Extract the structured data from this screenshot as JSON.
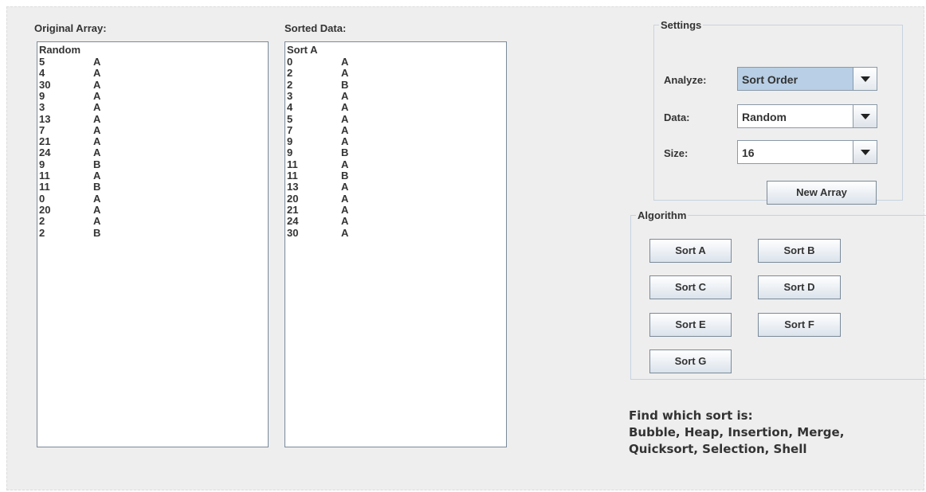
{
  "original": {
    "label": "Original Array:",
    "header": "Random",
    "rows": [
      {
        "num": "5",
        "letter": "A"
      },
      {
        "num": "4",
        "letter": "A"
      },
      {
        "num": "30",
        "letter": "A"
      },
      {
        "num": "9",
        "letter": "A"
      },
      {
        "num": "3",
        "letter": "A"
      },
      {
        "num": "13",
        "letter": "A"
      },
      {
        "num": "7",
        "letter": "A"
      },
      {
        "num": "21",
        "letter": "A"
      },
      {
        "num": "24",
        "letter": "A"
      },
      {
        "num": "9",
        "letter": "B"
      },
      {
        "num": "11",
        "letter": "A"
      },
      {
        "num": "11",
        "letter": "B"
      },
      {
        "num": "0",
        "letter": "A"
      },
      {
        "num": "20",
        "letter": "A"
      },
      {
        "num": "2",
        "letter": "A"
      },
      {
        "num": "2",
        "letter": "B"
      }
    ]
  },
  "sorted": {
    "label": "Sorted Data:",
    "header": "Sort A",
    "rows": [
      {
        "num": "0",
        "letter": "A"
      },
      {
        "num": "2",
        "letter": "A"
      },
      {
        "num": "2",
        "letter": "B"
      },
      {
        "num": "3",
        "letter": "A"
      },
      {
        "num": "4",
        "letter": "A"
      },
      {
        "num": "5",
        "letter": "A"
      },
      {
        "num": "7",
        "letter": "A"
      },
      {
        "num": "9",
        "letter": "A"
      },
      {
        "num": "9",
        "letter": "B"
      },
      {
        "num": "11",
        "letter": "A"
      },
      {
        "num": "11",
        "letter": "B"
      },
      {
        "num": "13",
        "letter": "A"
      },
      {
        "num": "20",
        "letter": "A"
      },
      {
        "num": "21",
        "letter": "A"
      },
      {
        "num": "24",
        "letter": "A"
      },
      {
        "num": "30",
        "letter": "A"
      }
    ]
  },
  "settings": {
    "title": "Settings",
    "analyze_label": "Analyze:",
    "analyze_value": "Sort Order",
    "data_label": "Data:",
    "data_value": "Random",
    "size_label": "Size:",
    "size_value": "16",
    "new_array_label": "New Array"
  },
  "algorithm": {
    "title": "Algorithm",
    "buttons": [
      "Sort A",
      "Sort B",
      "Sort C",
      "Sort D",
      "Sort E",
      "Sort F",
      "Sort G"
    ]
  },
  "hint": {
    "line1": "Find which sort is:",
    "line2": "Bubble, Heap, Insertion, Merge,",
    "line3": "Quicksort, Selection, Shell"
  }
}
